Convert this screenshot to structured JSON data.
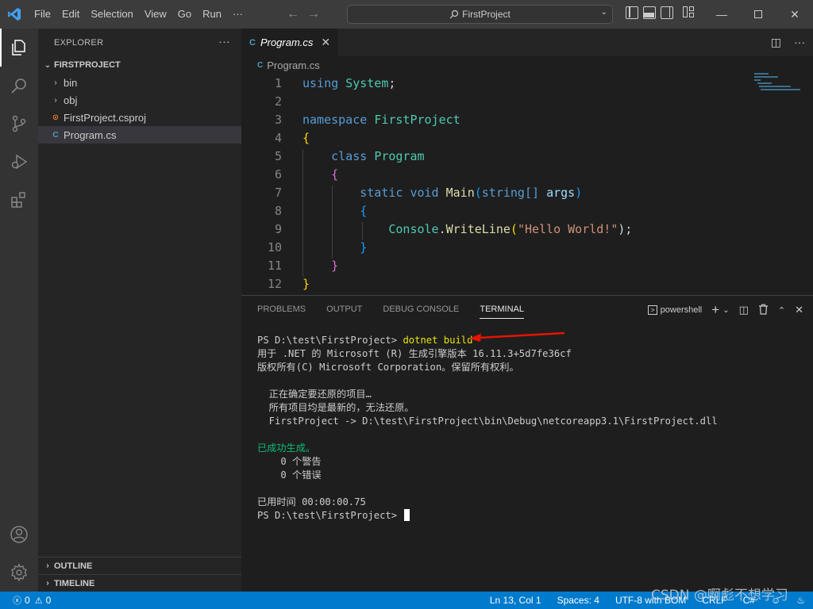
{
  "titlebar": {
    "menu": [
      "File",
      "Edit",
      "Selection",
      "View",
      "Go",
      "Run",
      "···"
    ],
    "search_text": "FirstProject"
  },
  "sidebar": {
    "title": "EXPLORER",
    "project": "FIRSTPROJECT",
    "items": [
      {
        "label": "bin",
        "kind": "folder"
      },
      {
        "label": "obj",
        "kind": "folder"
      },
      {
        "label": "FirstProject.csproj",
        "kind": "rss-file"
      },
      {
        "label": "Program.cs",
        "kind": "csharp-file"
      }
    ],
    "outline": "OUTLINE",
    "timeline": "TIMELINE"
  },
  "editor": {
    "tab_label": "Program.cs",
    "breadcrumb": "Program.cs",
    "line_numbers": [
      "1",
      "2",
      "3",
      "4",
      "5",
      "6",
      "7",
      "8",
      "9",
      "10",
      "11",
      "12"
    ],
    "code": {
      "l1_kw": "using",
      "l1_ns": "System",
      "l1_semi": ";",
      "l3_kw": "namespace",
      "l3_ns": "FirstProject",
      "l4_brace": "{",
      "l5_kw": "class",
      "l5_name": "Program",
      "l6_brace": "{",
      "l7_static": "static",
      "l7_void": "void",
      "l7_fn": "Main",
      "l7_open": "(",
      "l7_type": "string[]",
      "l7_arg": "args",
      "l7_close": ")",
      "l8_brace": "{",
      "l9_cls": "Console",
      "l9_dot": ".",
      "l9_fn": "WriteLine",
      "l9_open": "(",
      "l9_str": "\"Hello World!\"",
      "l9_close": ");",
      "l10_brace": "}",
      "l11_brace": "}",
      "l12_brace": "}"
    }
  },
  "panel": {
    "tabs": [
      "PROBLEMS",
      "OUTPUT",
      "DEBUG CONSOLE",
      "TERMINAL"
    ],
    "shell": "powershell",
    "terminal": {
      "prompt1": "PS D:\\test\\FirstProject> ",
      "command": "dotnet build",
      "lines": [
        "用于 .NET 的 Microsoft (R) 生成引擎版本 16.11.3+5d7fe36cf",
        "版权所有(C) Microsoft Corporation。保留所有权利。",
        "",
        "  正在确定要还原的项目…",
        "  所有项目均是最新的，无法还原。",
        "  FirstProject -> D:\\test\\FirstProject\\bin\\Debug\\netcoreapp3.1\\FirstProject.dll",
        ""
      ],
      "success": "已成功生成。",
      "warnings": "    0 个警告",
      "errors": "    0 个错误",
      "elapsed": "已用时间 00:00:00.75",
      "prompt2": "PS D:\\test\\FirstProject> "
    }
  },
  "statusbar": {
    "errors": "0",
    "warnings": "0",
    "position": "Ln 13, Col 1",
    "spaces": "Spaces: 4",
    "encoding": "UTF-8 with BOM",
    "eol": "CRLF",
    "language": "C#"
  },
  "watermark": "CSDN @啊彪不想学习",
  "colors": {
    "accent": "#007acc",
    "keyword": "#569cd6",
    "type": "#4ec9b0",
    "function": "#dcdcaa",
    "string": "#ce9178",
    "success": "#0dbc79",
    "annotation_arrow": "#e51400"
  }
}
